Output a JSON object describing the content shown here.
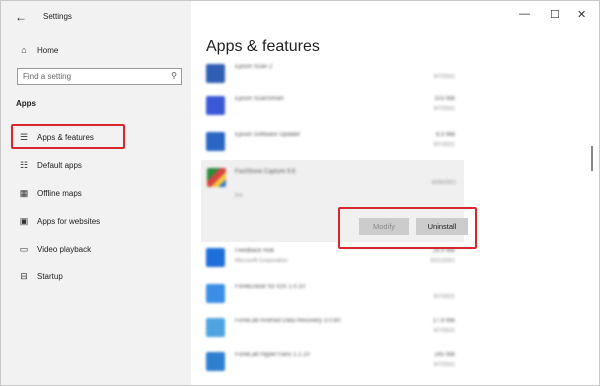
{
  "window": {
    "title": "Settings",
    "back_glyph": "←",
    "minimize_glyph": "—",
    "maximize_glyph": "☐",
    "close_glyph": "✕"
  },
  "sidebar": {
    "home": {
      "label": "Home",
      "icon": "home-icon"
    },
    "search": {
      "placeholder": "Find a setting",
      "icon": "search-icon"
    },
    "section_label": "Apps",
    "items": [
      {
        "label": "Apps & features",
        "icon": "list-icon",
        "selected": true
      },
      {
        "label": "Default apps",
        "icon": "default-apps-icon"
      },
      {
        "label": "Offline maps",
        "icon": "map-icon"
      },
      {
        "label": "Apps for websites",
        "icon": "web-icon"
      },
      {
        "label": "Video playback",
        "icon": "video-icon"
      },
      {
        "label": "Startup",
        "icon": "startup-icon"
      }
    ]
  },
  "main": {
    "title": "Apps & features",
    "apps": [
      {
        "name": "Epson Scan 2",
        "size": "",
        "date": "9/7/2021",
        "publisher": ""
      },
      {
        "name": "Epson ScanSmart",
        "size": "103 MB",
        "date": "9/7/2021",
        "publisher": ""
      },
      {
        "name": "Epson Software Updater",
        "size": "6.9 MB",
        "date": "9/7/2021",
        "publisher": ""
      },
      {
        "name": "FastStone Capture 9.6",
        "size": "",
        "date": "9/29/2021",
        "publisher": "",
        "version": "9.6",
        "expanded": true
      },
      {
        "name": "Feedback Hub",
        "size": "16.9 MB",
        "date": "6/21/2021",
        "publisher": "Microsoft Corporation"
      },
      {
        "name": "FoneEraser for iOS 1.0.10",
        "size": "",
        "date": "9/7/2021",
        "publisher": ""
      },
      {
        "name": "FoneLab Android Data Recovery 3.0.60",
        "size": "17.8 MB",
        "date": "9/7/2021",
        "publisher": ""
      },
      {
        "name": "FoneLab HyperTrans 1.1.10",
        "size": "245 MB",
        "date": "9/7/2021",
        "publisher": ""
      }
    ],
    "modify_label": "Modify",
    "uninstall_label": "Uninstall"
  },
  "colors": {
    "highlight": "#d8262e",
    "accent": "#0078d7"
  }
}
